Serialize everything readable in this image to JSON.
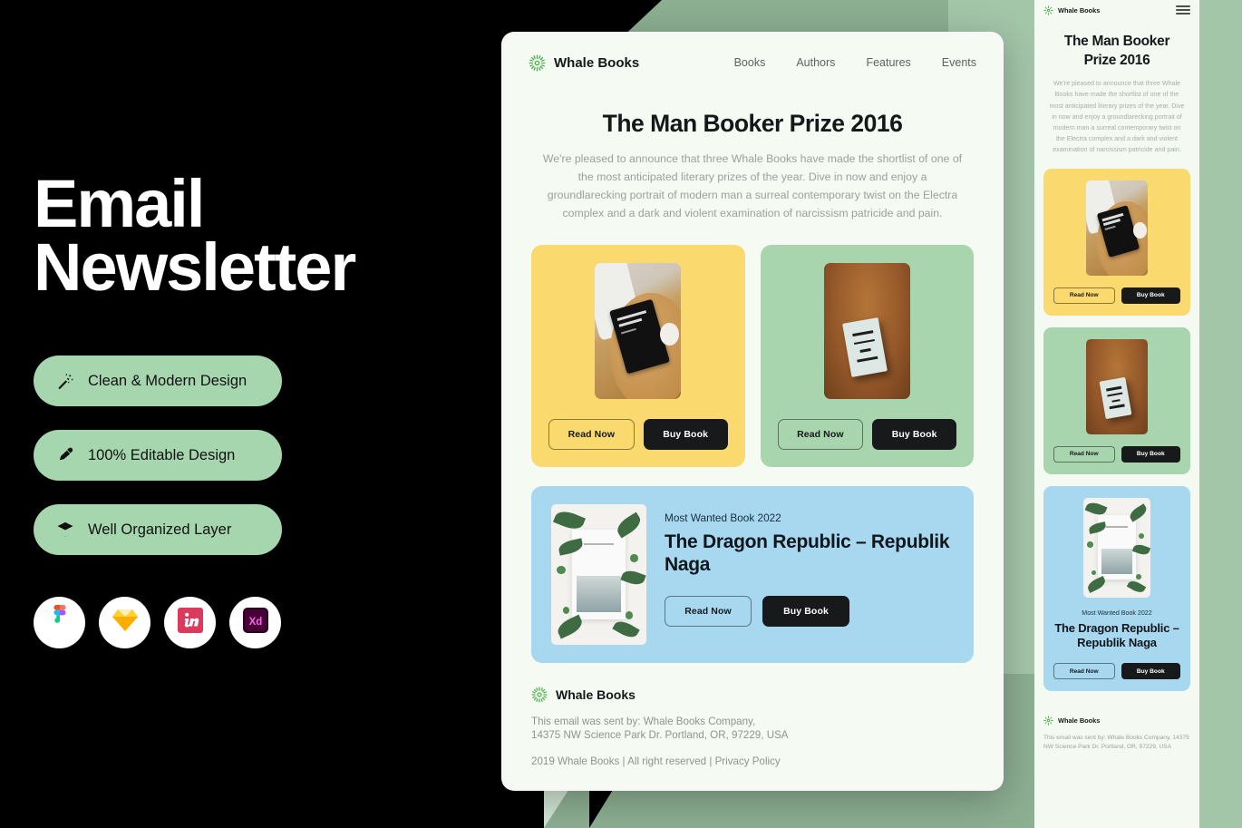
{
  "promo": {
    "title_line1": "Email",
    "title_line2": "Newsletter",
    "features": [
      {
        "label": "Clean & Modern  Design",
        "icon": "magic-wand-icon"
      },
      {
        "label": "100% Editable Design",
        "icon": "ink-brush-icon"
      },
      {
        "label": "Well Organized Layer",
        "icon": "layers-icon"
      }
    ],
    "app_badges": [
      {
        "name": "figma-logo",
        "label": "Figma"
      },
      {
        "name": "sketch-logo",
        "label": "Sketch"
      },
      {
        "name": "invision-logo",
        "label": "InVision"
      },
      {
        "name": "adobe-xd-logo",
        "label": "Xd"
      }
    ],
    "colors": {
      "pill_bg": "#a5d6ae",
      "page_bg": "#000000",
      "title": "#ffffff"
    }
  },
  "email": {
    "brand": "Whale Books",
    "logo_icon": "sunburst-icon",
    "nav": [
      {
        "label": "Books"
      },
      {
        "label": "Authors"
      },
      {
        "label": "Features"
      },
      {
        "label": "Events"
      }
    ],
    "hero": {
      "title": "The Man Booker Prize 2016",
      "body": "We're pleased to announce that three Whale Books have made the shortlist of one of the most anticipated literary prizes of the year. Dive in now and enjoy a groundlarecking portrait of modern man a surreal contemporary twist on the Electra complex and a dark and violent examination of narcissism patricide and pain."
    },
    "cards": [
      {
        "theme": "yellow",
        "color": "#fada6e",
        "photo": "milk-and-honey-book-photo",
        "read_label": "Read Now",
        "buy_label": "Buy Book"
      },
      {
        "theme": "green",
        "color": "#a8d4ae",
        "photo": "a-book-full-of-hope-photo",
        "read_label": "Read Now",
        "buy_label": "Buy Book"
      }
    ],
    "feature_card": {
      "color": "#a8d7f0",
      "photo": "psalms-book-photo",
      "kicker": "Most Wanted Book 2022",
      "title": "The Dragon Republic – Republik Naga",
      "read_label": "Read Now",
      "buy_label": "Buy Book"
    },
    "footer": {
      "brand": "Whale Books",
      "address_line1": "This email was sent by: Whale Books Company,",
      "address_line2": "14375 NW Science Park Dr. Portland, OR, 97229, USA",
      "legal": "2019 Whale Books | All right reserved | Privacy Policy"
    }
  },
  "mobile": {
    "brand": "Whale Books",
    "menu_icon": "hamburger-menu-icon",
    "hero": {
      "title": "The Man Booker Prize 2016",
      "body": "We're pleased to announce that three Whale Books have made the shortlist of one of the most anticipated literary prizes of the year. Dive in now and enjoy a groundlarecking portrait of modern man a surreal contemporary twist on the Electra complex and a dark and violent examination of narcissism patricide and pain."
    },
    "cards": [
      {
        "theme": "yellow",
        "read_label": "Read Now",
        "buy_label": "Buy Book"
      },
      {
        "theme": "green",
        "read_label": "Read Now",
        "buy_label": "Buy Book"
      }
    ],
    "feature_card": {
      "kicker": "Most Wanted Book 2022",
      "title": "The Dragon Republic – Republik Naga",
      "read_label": "Read Now",
      "buy_label": "Buy Book"
    },
    "footer": {
      "brand": "Whale Books",
      "address": "This email was sent by: Whale Books Company, 14375 NW Science Park Dr. Portland, OR, 97229, USA"
    }
  }
}
